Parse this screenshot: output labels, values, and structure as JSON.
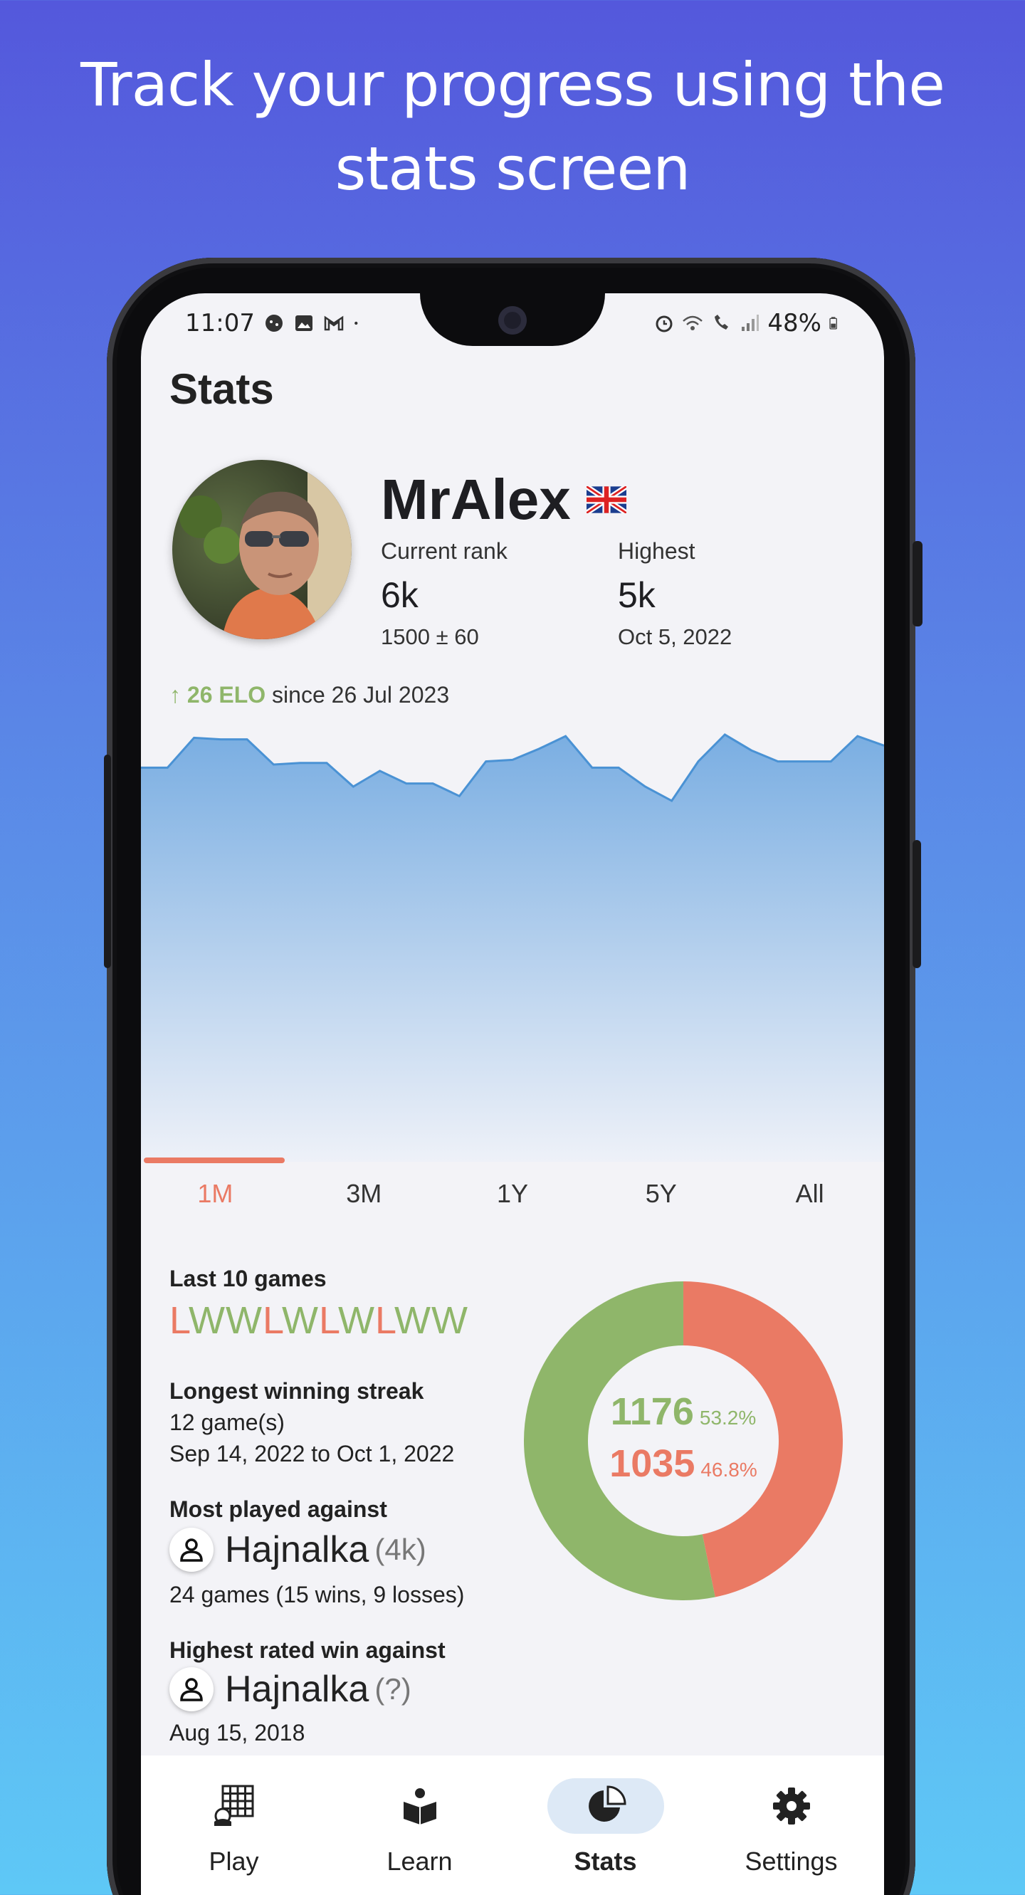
{
  "headline": {
    "line1": "Track your progress using the",
    "line2": "stats screen"
  },
  "status_bar": {
    "time": "11:07",
    "battery": "48%",
    "icons_left": [
      "game-icon",
      "image-icon",
      "gmail-icon",
      "dot-icon"
    ],
    "icons_right": [
      "alarm-icon",
      "wifi-icon",
      "wifi-call-icon",
      "signal-icon",
      "battery-icon"
    ]
  },
  "page": {
    "title": "Stats"
  },
  "profile": {
    "username": "MrAlex",
    "flag": "uk-flag-icon",
    "current_rank_label": "Current rank",
    "current_rank": "6k",
    "current_rating": "1500 ± 60",
    "highest_label": "Highest",
    "highest_rank": "5k",
    "highest_date": "Oct 5, 2022"
  },
  "elo": {
    "arrow": "↑",
    "gain": "26 ELO",
    "since": "since 26 Jul 2023"
  },
  "chart_data": {
    "type": "area",
    "title": "",
    "xlabel": "",
    "ylabel": "",
    "x": [
      0,
      1,
      2,
      3,
      4,
      5,
      6,
      7,
      8,
      9,
      10,
      11,
      12,
      13,
      14,
      15,
      16,
      17,
      18,
      19,
      20,
      21,
      22,
      23,
      24,
      25,
      26,
      27,
      28
    ],
    "series": [
      {
        "values": [
          1500,
          1500,
          1519,
          1518,
          1518,
          1502,
          1503,
          1503,
          1488,
          1498,
          1490,
          1490,
          1482,
          1504,
          1505,
          1512,
          1520,
          1500,
          1500,
          1488,
          1479,
          1504,
          1521,
          1511,
          1504,
          1504,
          1504,
          1520,
          1514
        ],
        "color": "#4a92d4"
      }
    ],
    "ylim": [
      1250,
      1530
    ],
    "grid": false,
    "legend": "none"
  },
  "range_tabs": [
    "1M",
    "3M",
    "1Y",
    "5Y",
    "All"
  ],
  "active_range": "1M",
  "last_games": {
    "label": "Last 10 games",
    "results": [
      "L",
      "W",
      "W",
      "L",
      "W",
      "L",
      "W",
      "L",
      "W",
      "W"
    ]
  },
  "streak": {
    "label": "Longest winning streak",
    "games": "12 game(s)",
    "range": "Sep 14, 2022 to Oct 1, 2022"
  },
  "most_played": {
    "label": "Most played against",
    "name": "Hajnalka",
    "rank": "(4k)",
    "detail": "24 games (15 wins, 9 losses)"
  },
  "highest_win": {
    "label": "Highest rated win against",
    "name": "Hajnalka",
    "rank": "(?)",
    "date": "Aug 15, 2018"
  },
  "record": {
    "wins": "1176",
    "wins_pct": "53.2%",
    "wins_share": 0.532,
    "losses": "1035",
    "losses_pct": "46.8%",
    "losses_share": 0.468,
    "win_color": "#8fb66a",
    "loss_color": "#ea7a64"
  },
  "nav": [
    {
      "label": "Play",
      "icon": "board-icon"
    },
    {
      "label": "Learn",
      "icon": "book-icon"
    },
    {
      "label": "Stats",
      "icon": "pie-chart-icon"
    },
    {
      "label": "Settings",
      "icon": "gear-icon"
    }
  ]
}
